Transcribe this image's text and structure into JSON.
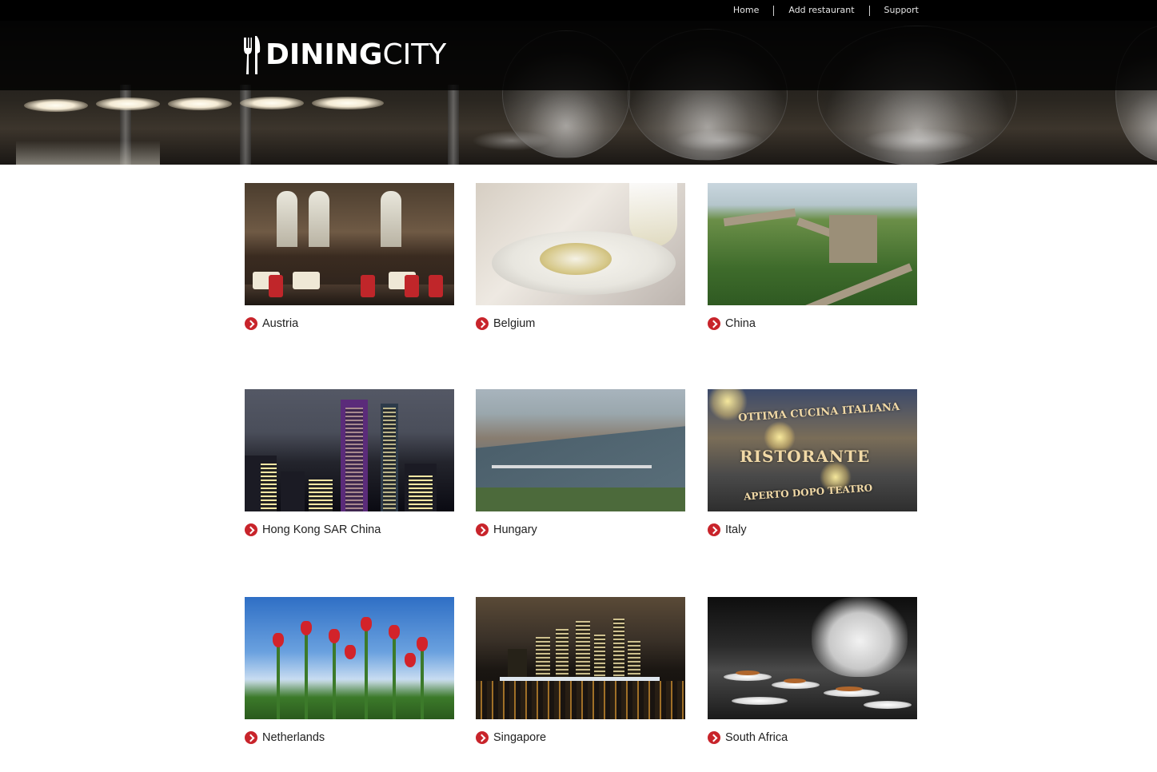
{
  "topnav": {
    "links": [
      {
        "label": "Home"
      },
      {
        "label": "Add restaurant"
      },
      {
        "label": "Support"
      }
    ]
  },
  "logo": {
    "bold": "DINING",
    "thin": "CITY"
  },
  "countries": [
    {
      "name": "Austria",
      "scene": "restaurant interior"
    },
    {
      "name": "Belgium",
      "scene": "plated dish with wine"
    },
    {
      "name": "China",
      "scene": "great wall"
    },
    {
      "name": "Hong Kong SAR China",
      "scene": "skyline at night"
    },
    {
      "name": "Hungary",
      "scene": "river and bridge"
    },
    {
      "name": "Italy",
      "scene": "ristorante sign"
    },
    {
      "name": "Netherlands",
      "scene": "tulips"
    },
    {
      "name": "Singapore",
      "scene": "skyline at night over water"
    },
    {
      "name": "South Africa",
      "scene": "chef plating"
    }
  ],
  "italy_sign": {
    "line1": "OTTIMA CUCINA ITALIANA",
    "line2": "RISTORANTE",
    "line3": "APERTO DOPO TEATRO"
  },
  "colors": {
    "topnav_bg": "#000000",
    "arrow_icon": "#c8242b",
    "country_text": "#222222"
  },
  "icons": {
    "logo": "fork-knife-logo-icon",
    "country_bullet": "arrow-right-circle-icon"
  }
}
